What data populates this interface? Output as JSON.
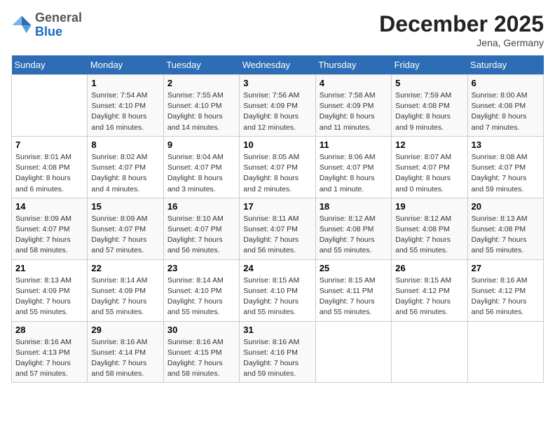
{
  "header": {
    "logo_line1": "General",
    "logo_line2": "Blue",
    "month": "December 2025",
    "location": "Jena, Germany"
  },
  "weekdays": [
    "Sunday",
    "Monday",
    "Tuesday",
    "Wednesday",
    "Thursday",
    "Friday",
    "Saturday"
  ],
  "weeks": [
    [
      {
        "day": "",
        "info": ""
      },
      {
        "day": "1",
        "info": "Sunrise: 7:54 AM\nSunset: 4:10 PM\nDaylight: 8 hours\nand 16 minutes."
      },
      {
        "day": "2",
        "info": "Sunrise: 7:55 AM\nSunset: 4:10 PM\nDaylight: 8 hours\nand 14 minutes."
      },
      {
        "day": "3",
        "info": "Sunrise: 7:56 AM\nSunset: 4:09 PM\nDaylight: 8 hours\nand 12 minutes."
      },
      {
        "day": "4",
        "info": "Sunrise: 7:58 AM\nSunset: 4:09 PM\nDaylight: 8 hours\nand 11 minutes."
      },
      {
        "day": "5",
        "info": "Sunrise: 7:59 AM\nSunset: 4:08 PM\nDaylight: 8 hours\nand 9 minutes."
      },
      {
        "day": "6",
        "info": "Sunrise: 8:00 AM\nSunset: 4:08 PM\nDaylight: 8 hours\nand 7 minutes."
      }
    ],
    [
      {
        "day": "7",
        "info": "Sunrise: 8:01 AM\nSunset: 4:08 PM\nDaylight: 8 hours\nand 6 minutes."
      },
      {
        "day": "8",
        "info": "Sunrise: 8:02 AM\nSunset: 4:07 PM\nDaylight: 8 hours\nand 4 minutes."
      },
      {
        "day": "9",
        "info": "Sunrise: 8:04 AM\nSunset: 4:07 PM\nDaylight: 8 hours\nand 3 minutes."
      },
      {
        "day": "10",
        "info": "Sunrise: 8:05 AM\nSunset: 4:07 PM\nDaylight: 8 hours\nand 2 minutes."
      },
      {
        "day": "11",
        "info": "Sunrise: 8:06 AM\nSunset: 4:07 PM\nDaylight: 8 hours\nand 1 minute."
      },
      {
        "day": "12",
        "info": "Sunrise: 8:07 AM\nSunset: 4:07 PM\nDaylight: 8 hours\nand 0 minutes."
      },
      {
        "day": "13",
        "info": "Sunrise: 8:08 AM\nSunset: 4:07 PM\nDaylight: 7 hours\nand 59 minutes."
      }
    ],
    [
      {
        "day": "14",
        "info": "Sunrise: 8:09 AM\nSunset: 4:07 PM\nDaylight: 7 hours\nand 58 minutes."
      },
      {
        "day": "15",
        "info": "Sunrise: 8:09 AM\nSunset: 4:07 PM\nDaylight: 7 hours\nand 57 minutes."
      },
      {
        "day": "16",
        "info": "Sunrise: 8:10 AM\nSunset: 4:07 PM\nDaylight: 7 hours\nand 56 minutes."
      },
      {
        "day": "17",
        "info": "Sunrise: 8:11 AM\nSunset: 4:07 PM\nDaylight: 7 hours\nand 56 minutes."
      },
      {
        "day": "18",
        "info": "Sunrise: 8:12 AM\nSunset: 4:08 PM\nDaylight: 7 hours\nand 55 minutes."
      },
      {
        "day": "19",
        "info": "Sunrise: 8:12 AM\nSunset: 4:08 PM\nDaylight: 7 hours\nand 55 minutes."
      },
      {
        "day": "20",
        "info": "Sunrise: 8:13 AM\nSunset: 4:08 PM\nDaylight: 7 hours\nand 55 minutes."
      }
    ],
    [
      {
        "day": "21",
        "info": "Sunrise: 8:13 AM\nSunset: 4:09 PM\nDaylight: 7 hours\nand 55 minutes."
      },
      {
        "day": "22",
        "info": "Sunrise: 8:14 AM\nSunset: 4:09 PM\nDaylight: 7 hours\nand 55 minutes."
      },
      {
        "day": "23",
        "info": "Sunrise: 8:14 AM\nSunset: 4:10 PM\nDaylight: 7 hours\nand 55 minutes."
      },
      {
        "day": "24",
        "info": "Sunrise: 8:15 AM\nSunset: 4:10 PM\nDaylight: 7 hours\nand 55 minutes."
      },
      {
        "day": "25",
        "info": "Sunrise: 8:15 AM\nSunset: 4:11 PM\nDaylight: 7 hours\nand 55 minutes."
      },
      {
        "day": "26",
        "info": "Sunrise: 8:15 AM\nSunset: 4:12 PM\nDaylight: 7 hours\nand 56 minutes."
      },
      {
        "day": "27",
        "info": "Sunrise: 8:16 AM\nSunset: 4:12 PM\nDaylight: 7 hours\nand 56 minutes."
      }
    ],
    [
      {
        "day": "28",
        "info": "Sunrise: 8:16 AM\nSunset: 4:13 PM\nDaylight: 7 hours\nand 57 minutes."
      },
      {
        "day": "29",
        "info": "Sunrise: 8:16 AM\nSunset: 4:14 PM\nDaylight: 7 hours\nand 58 minutes."
      },
      {
        "day": "30",
        "info": "Sunrise: 8:16 AM\nSunset: 4:15 PM\nDaylight: 7 hours\nand 58 minutes."
      },
      {
        "day": "31",
        "info": "Sunrise: 8:16 AM\nSunset: 4:16 PM\nDaylight: 7 hours\nand 59 minutes."
      },
      {
        "day": "",
        "info": ""
      },
      {
        "day": "",
        "info": ""
      },
      {
        "day": "",
        "info": ""
      }
    ]
  ]
}
